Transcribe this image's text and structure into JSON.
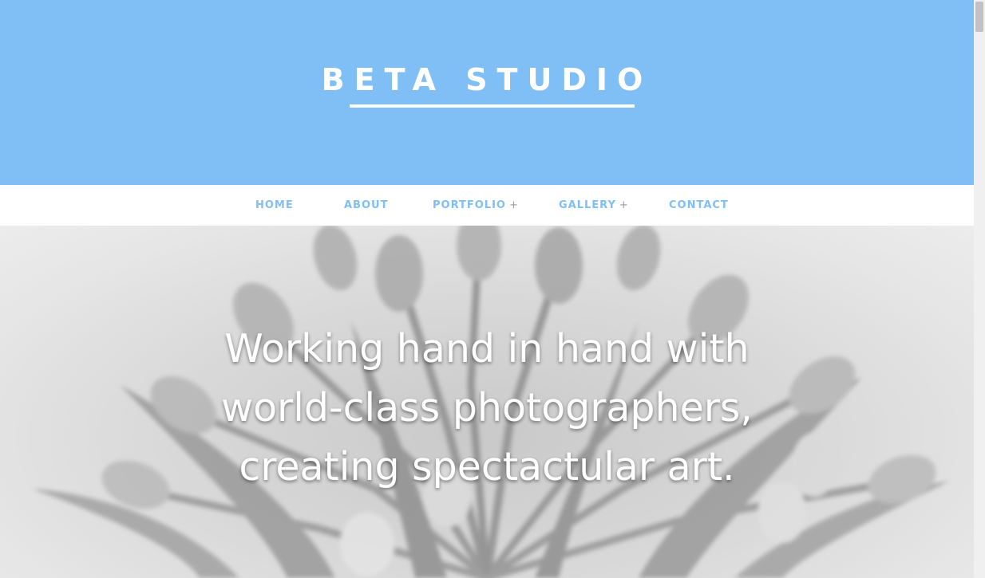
{
  "site": {
    "title": "BETA STUDIO"
  },
  "nav": {
    "items": [
      {
        "label": "HOME",
        "has_submenu": false
      },
      {
        "label": "ABOUT",
        "has_submenu": false
      },
      {
        "label": "PORTFOLIO",
        "has_submenu": true,
        "submenu_marker": "+"
      },
      {
        "label": "GALLERY",
        "has_submenu": true,
        "submenu_marker": "+"
      },
      {
        "label": "CONTACT",
        "has_submenu": false
      }
    ]
  },
  "hero": {
    "lines": [
      "Working hand in hand with",
      "world-class photographers,",
      "creating  spectactular art."
    ],
    "background_icon": "tulip-bouquet-photo"
  },
  "colors": {
    "accent": "#7fbff5",
    "header_bg": "#7fbff5",
    "nav_bg": "#ffffff",
    "submenu_marker": "#9a9a9a"
  }
}
